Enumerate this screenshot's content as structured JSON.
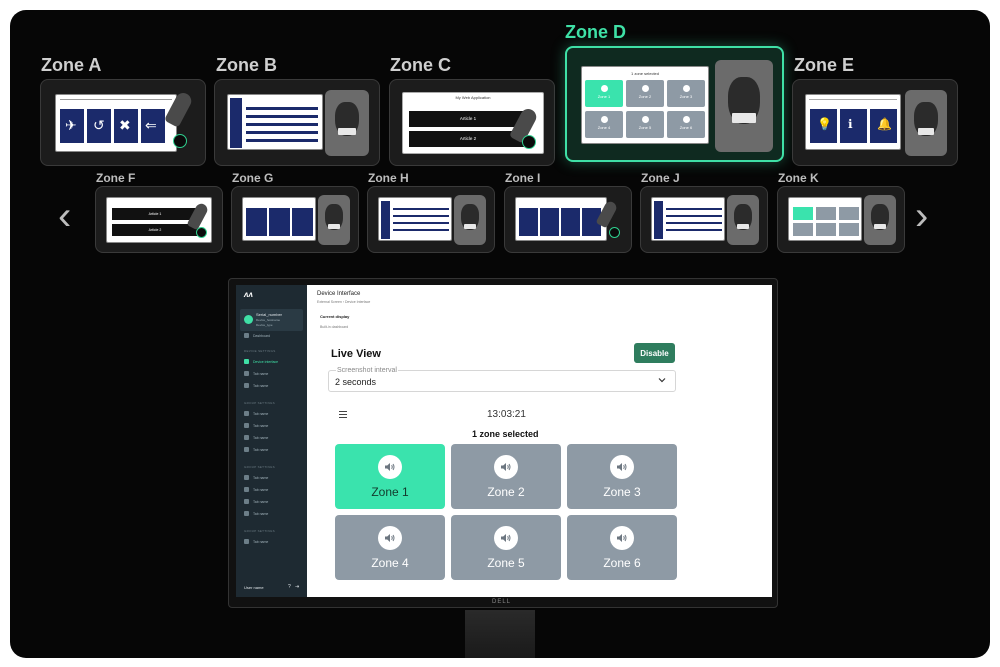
{
  "top_zones": [
    {
      "label": "Zone A"
    },
    {
      "label": "Zone B"
    },
    {
      "label": "Zone C"
    },
    {
      "label": "Zone D",
      "active": true
    },
    {
      "label": "Zone E"
    }
  ],
  "bottom_zones": [
    {
      "label": "Zone F"
    },
    {
      "label": "Zone G"
    },
    {
      "label": "Zone H"
    },
    {
      "label": "Zone I"
    },
    {
      "label": "Zone J"
    },
    {
      "label": "Zone K"
    }
  ],
  "thumb_text": {
    "zone_c_header": "My Web Application",
    "zone_c_article1": "Article 1",
    "zone_c_article2": "Article 2",
    "zone_d_header": "1 zone selected",
    "zone_d_tiles": [
      "Zone 1",
      "Zone 2",
      "Zone 3",
      "Zone 4",
      "Zone 5",
      "Zone 6"
    ],
    "zone_f_article1": "Article 1",
    "zone_f_article2": "Article 2"
  },
  "nav": {
    "prev_icon": "chevron-left-icon",
    "next_icon": "chevron-right-icon"
  },
  "monitor": {
    "brand": "DELL",
    "sidebar": {
      "serial_label": "Serial_number",
      "serial_sub1": "Device_hostname",
      "serial_sub2": "Device_type",
      "dashboard": "Dashboard",
      "section1": "DEVICE SETTINGS",
      "item_device_interface": "Device interface",
      "item_a": "Tab name",
      "item_b": "Tab name",
      "section2": "GROUP SETTINGS",
      "item_c": "Tab name",
      "item_d": "Tab name",
      "item_e": "Tab name",
      "item_f": "Tab name",
      "section3": "GROUP SETTINGS",
      "item_g": "Tab name",
      "item_h": "Tab name",
      "item_i": "Tab name",
      "item_j": "Tab name",
      "section4": "GROUP SETTINGS",
      "item_k": "Tab name",
      "user_name": "User name"
    },
    "app": {
      "page_title": "Device Interface",
      "breadcrumb": "External Screen  ›  Device Interface",
      "current_display_label": "Current display",
      "current_display_value": "Built-in dashboard",
      "live_view_title": "Live View",
      "disable_label": "Disable",
      "interval_label": "Screenshot interval",
      "interval_value": "2 seconds",
      "clock": "13:03:21",
      "selected_text": "1 zone selected",
      "zones": [
        {
          "label": "Zone 1",
          "selected": true
        },
        {
          "label": "Zone 2",
          "selected": false
        },
        {
          "label": "Zone 3",
          "selected": false
        },
        {
          "label": "Zone 4",
          "selected": false
        },
        {
          "label": "Zone 5",
          "selected": false
        },
        {
          "label": "Zone 6",
          "selected": false
        }
      ]
    }
  },
  "colors": {
    "accent": "#3fe0a6",
    "zone_selected": "#3ae3ad",
    "zone_idle": "#8e9aa5",
    "navy": "#1b2a6b",
    "button": "#2f7d5e"
  }
}
